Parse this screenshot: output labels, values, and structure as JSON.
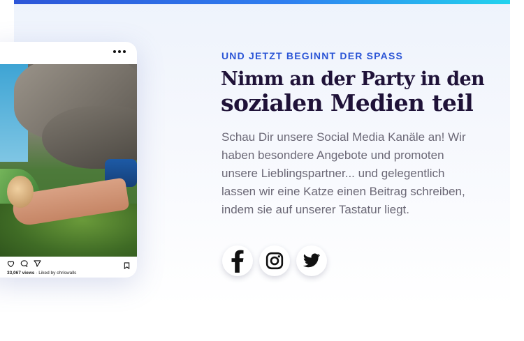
{
  "section": {
    "eyebrow": "UND JETZT BEGINNT DER SPASS",
    "headline_line1": "Nimm an der Party in den",
    "headline_line2": "sozialen Medien teil",
    "body": "Schau Dir unsere Social Media Kanäle an! Wir haben besondere Angebote und promoten unsere Lieblingspartner... und gelegentlich lassen wir eine Katze einen Beitrag schreiben, indem sie auf unserer Tastatur liegt."
  },
  "post": {
    "views": "33,067 views",
    "liked_by": "· Liked by chriswalls",
    "icons": [
      "more-icon",
      "heart-icon",
      "comment-icon",
      "share-icon",
      "bookmark-icon"
    ]
  },
  "socials": [
    {
      "name": "facebook-icon"
    },
    {
      "name": "instagram-icon"
    },
    {
      "name": "twitter-icon"
    }
  ],
  "colors": {
    "accent": "#2b55d6",
    "headline": "#1f1238",
    "body": "#6b6876",
    "top_bar_start": "#2d56d8",
    "top_bar_end": "#22d3ee"
  }
}
